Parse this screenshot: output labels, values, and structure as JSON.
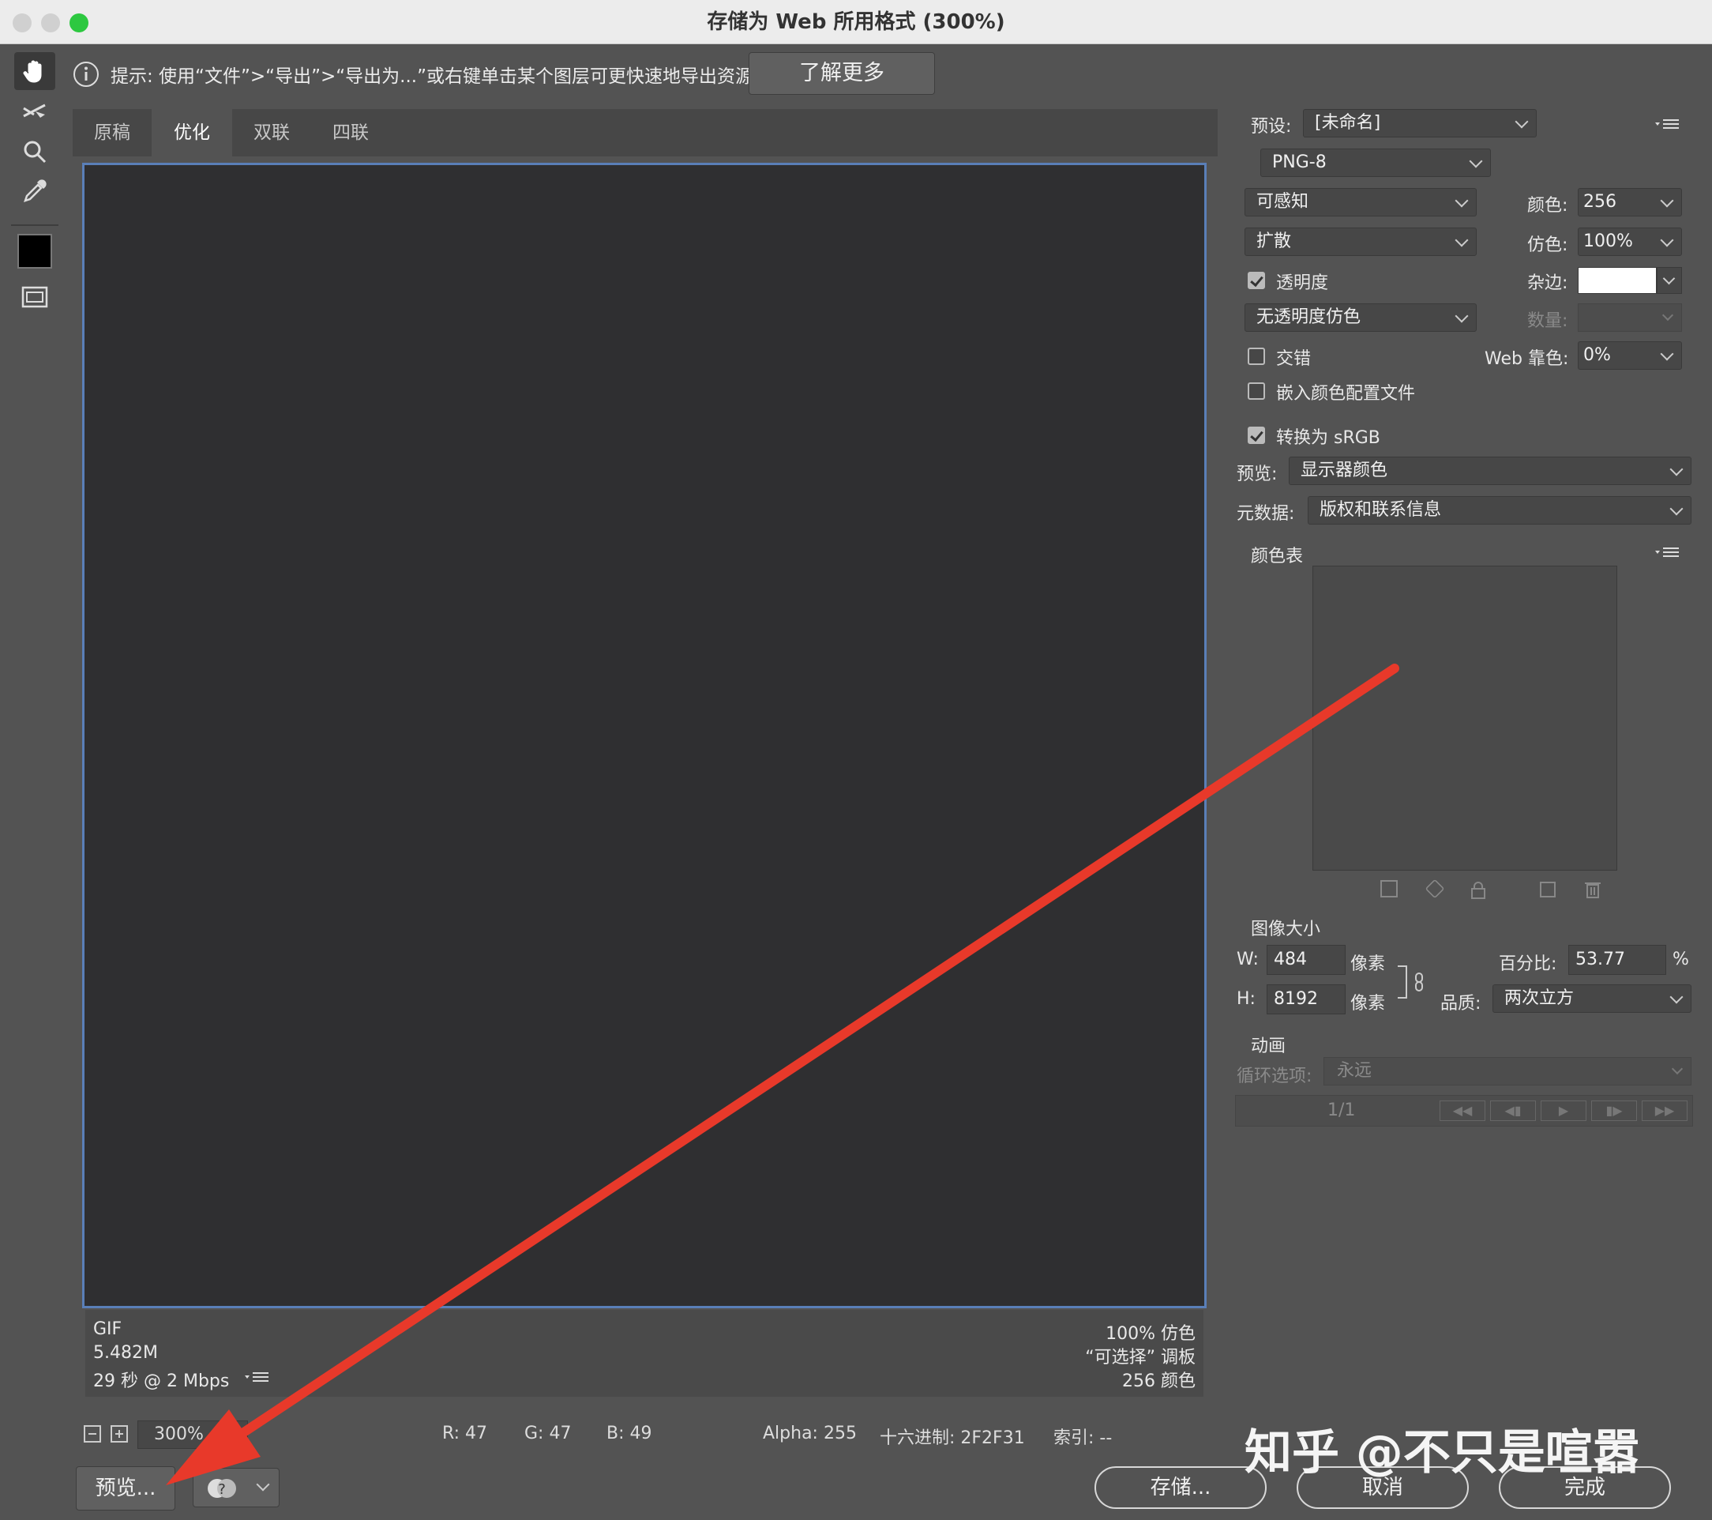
{
  "window": {
    "title": "存储为 Web 所用格式 (300%)"
  },
  "hint": {
    "text": "提示: 使用“文件”>“导出”>“导出为...”或右键单击某个图层可更快速地导出资源",
    "learn_more": "了解更多"
  },
  "tabs": [
    "原稿",
    "优化",
    "双联",
    "四联"
  ],
  "info": {
    "format": "GIF",
    "size": "5.482M",
    "time": "29 秒 @ 2 Mbps",
    "dither": "100% 仿色",
    "palette": "“可选择” 调板",
    "colors": "256 颜色"
  },
  "status": {
    "zoom": "300%",
    "r": "R: 47",
    "g": "G: 47",
    "b": "B: 49",
    "alpha": "Alpha: 255",
    "hex": "十六进制: 2F2F31",
    "index": "索引: --"
  },
  "bottom": {
    "preview": "预览...",
    "save": "存储...",
    "cancel": "取消",
    "done": "完成"
  },
  "watermark": "知乎 @不只是喧嚣",
  "settings": {
    "preset_label": "预设:",
    "preset_value": "[未命名]",
    "format_value": "PNG-8",
    "reduction_value": "可感知",
    "colors_label": "颜色:",
    "colors_value": "256",
    "dither_algo_value": "扩散",
    "dither_label": "仿色:",
    "dither_value": "100%",
    "transparency_label": "透明度",
    "transparency_checked": true,
    "matte_label": "杂边:",
    "trans_dither_value": "无透明度仿色",
    "amount_label": "数量:",
    "interlaced_label": "交错",
    "interlaced_checked": false,
    "web_snap_label": "Web 靠色:",
    "web_snap_value": "0%",
    "embed_profile_label": "嵌入颜色配置文件",
    "embed_profile_checked": false,
    "convert_srgb_label": "转换为 sRGB",
    "convert_srgb_checked": true,
    "preview_label": "预览:",
    "preview_value": "显示器颜色",
    "metadata_label": "元数据:",
    "metadata_value": "版权和联系信息"
  },
  "color_table": {
    "title": "颜色表"
  },
  "image_size": {
    "title": "图像大小",
    "w_label": "W:",
    "w_value": "484",
    "h_label": "H:",
    "h_value": "8192",
    "unit": "像素",
    "percent_label": "百分比:",
    "percent_value": "53.77",
    "percent_unit": "%",
    "quality_label": "品质:",
    "quality_value": "两次立方"
  },
  "animation": {
    "title": "动画",
    "loop_label": "循环选项:",
    "loop_value": "永远",
    "frame": "1/1"
  },
  "colors": {
    "selection_border": "#5a7fb8",
    "arrow": "#e8392a",
    "canvas": "#2f2f31"
  }
}
